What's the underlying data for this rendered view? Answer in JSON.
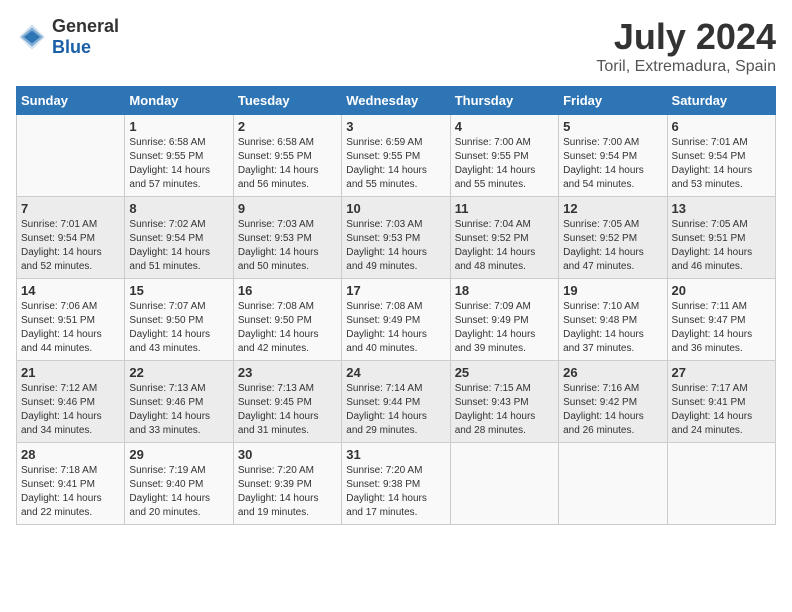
{
  "logo": {
    "general": "General",
    "blue": "Blue"
  },
  "title": {
    "month_year": "July 2024",
    "location": "Toril, Extremadura, Spain"
  },
  "weekdays": [
    "Sunday",
    "Monday",
    "Tuesday",
    "Wednesday",
    "Thursday",
    "Friday",
    "Saturday"
  ],
  "weeks": [
    [
      {
        "day": "",
        "sunrise": "",
        "sunset": "",
        "daylight": ""
      },
      {
        "day": "1",
        "sunrise": "Sunrise: 6:58 AM",
        "sunset": "Sunset: 9:55 PM",
        "daylight": "Daylight: 14 hours and 57 minutes."
      },
      {
        "day": "2",
        "sunrise": "Sunrise: 6:58 AM",
        "sunset": "Sunset: 9:55 PM",
        "daylight": "Daylight: 14 hours and 56 minutes."
      },
      {
        "day": "3",
        "sunrise": "Sunrise: 6:59 AM",
        "sunset": "Sunset: 9:55 PM",
        "daylight": "Daylight: 14 hours and 55 minutes."
      },
      {
        "day": "4",
        "sunrise": "Sunrise: 7:00 AM",
        "sunset": "Sunset: 9:55 PM",
        "daylight": "Daylight: 14 hours and 55 minutes."
      },
      {
        "day": "5",
        "sunrise": "Sunrise: 7:00 AM",
        "sunset": "Sunset: 9:54 PM",
        "daylight": "Daylight: 14 hours and 54 minutes."
      },
      {
        "day": "6",
        "sunrise": "Sunrise: 7:01 AM",
        "sunset": "Sunset: 9:54 PM",
        "daylight": "Daylight: 14 hours and 53 minutes."
      }
    ],
    [
      {
        "day": "7",
        "sunrise": "Sunrise: 7:01 AM",
        "sunset": "Sunset: 9:54 PM",
        "daylight": "Daylight: 14 hours and 52 minutes."
      },
      {
        "day": "8",
        "sunrise": "Sunrise: 7:02 AM",
        "sunset": "Sunset: 9:54 PM",
        "daylight": "Daylight: 14 hours and 51 minutes."
      },
      {
        "day": "9",
        "sunrise": "Sunrise: 7:03 AM",
        "sunset": "Sunset: 9:53 PM",
        "daylight": "Daylight: 14 hours and 50 minutes."
      },
      {
        "day": "10",
        "sunrise": "Sunrise: 7:03 AM",
        "sunset": "Sunset: 9:53 PM",
        "daylight": "Daylight: 14 hours and 49 minutes."
      },
      {
        "day": "11",
        "sunrise": "Sunrise: 7:04 AM",
        "sunset": "Sunset: 9:52 PM",
        "daylight": "Daylight: 14 hours and 48 minutes."
      },
      {
        "day": "12",
        "sunrise": "Sunrise: 7:05 AM",
        "sunset": "Sunset: 9:52 PM",
        "daylight": "Daylight: 14 hours and 47 minutes."
      },
      {
        "day": "13",
        "sunrise": "Sunrise: 7:05 AM",
        "sunset": "Sunset: 9:51 PM",
        "daylight": "Daylight: 14 hours and 46 minutes."
      }
    ],
    [
      {
        "day": "14",
        "sunrise": "Sunrise: 7:06 AM",
        "sunset": "Sunset: 9:51 PM",
        "daylight": "Daylight: 14 hours and 44 minutes."
      },
      {
        "day": "15",
        "sunrise": "Sunrise: 7:07 AM",
        "sunset": "Sunset: 9:50 PM",
        "daylight": "Daylight: 14 hours and 43 minutes."
      },
      {
        "day": "16",
        "sunrise": "Sunrise: 7:08 AM",
        "sunset": "Sunset: 9:50 PM",
        "daylight": "Daylight: 14 hours and 42 minutes."
      },
      {
        "day": "17",
        "sunrise": "Sunrise: 7:08 AM",
        "sunset": "Sunset: 9:49 PM",
        "daylight": "Daylight: 14 hours and 40 minutes."
      },
      {
        "day": "18",
        "sunrise": "Sunrise: 7:09 AM",
        "sunset": "Sunset: 9:49 PM",
        "daylight": "Daylight: 14 hours and 39 minutes."
      },
      {
        "day": "19",
        "sunrise": "Sunrise: 7:10 AM",
        "sunset": "Sunset: 9:48 PM",
        "daylight": "Daylight: 14 hours and 37 minutes."
      },
      {
        "day": "20",
        "sunrise": "Sunrise: 7:11 AM",
        "sunset": "Sunset: 9:47 PM",
        "daylight": "Daylight: 14 hours and 36 minutes."
      }
    ],
    [
      {
        "day": "21",
        "sunrise": "Sunrise: 7:12 AM",
        "sunset": "Sunset: 9:46 PM",
        "daylight": "Daylight: 14 hours and 34 minutes."
      },
      {
        "day": "22",
        "sunrise": "Sunrise: 7:13 AM",
        "sunset": "Sunset: 9:46 PM",
        "daylight": "Daylight: 14 hours and 33 minutes."
      },
      {
        "day": "23",
        "sunrise": "Sunrise: 7:13 AM",
        "sunset": "Sunset: 9:45 PM",
        "daylight": "Daylight: 14 hours and 31 minutes."
      },
      {
        "day": "24",
        "sunrise": "Sunrise: 7:14 AM",
        "sunset": "Sunset: 9:44 PM",
        "daylight": "Daylight: 14 hours and 29 minutes."
      },
      {
        "day": "25",
        "sunrise": "Sunrise: 7:15 AM",
        "sunset": "Sunset: 9:43 PM",
        "daylight": "Daylight: 14 hours and 28 minutes."
      },
      {
        "day": "26",
        "sunrise": "Sunrise: 7:16 AM",
        "sunset": "Sunset: 9:42 PM",
        "daylight": "Daylight: 14 hours and 26 minutes."
      },
      {
        "day": "27",
        "sunrise": "Sunrise: 7:17 AM",
        "sunset": "Sunset: 9:41 PM",
        "daylight": "Daylight: 14 hours and 24 minutes."
      }
    ],
    [
      {
        "day": "28",
        "sunrise": "Sunrise: 7:18 AM",
        "sunset": "Sunset: 9:41 PM",
        "daylight": "Daylight: 14 hours and 22 minutes."
      },
      {
        "day": "29",
        "sunrise": "Sunrise: 7:19 AM",
        "sunset": "Sunset: 9:40 PM",
        "daylight": "Daylight: 14 hours and 20 minutes."
      },
      {
        "day": "30",
        "sunrise": "Sunrise: 7:20 AM",
        "sunset": "Sunset: 9:39 PM",
        "daylight": "Daylight: 14 hours and 19 minutes."
      },
      {
        "day": "31",
        "sunrise": "Sunrise: 7:20 AM",
        "sunset": "Sunset: 9:38 PM",
        "daylight": "Daylight: 14 hours and 17 minutes."
      },
      {
        "day": "",
        "sunrise": "",
        "sunset": "",
        "daylight": ""
      },
      {
        "day": "",
        "sunrise": "",
        "sunset": "",
        "daylight": ""
      },
      {
        "day": "",
        "sunrise": "",
        "sunset": "",
        "daylight": ""
      }
    ]
  ]
}
